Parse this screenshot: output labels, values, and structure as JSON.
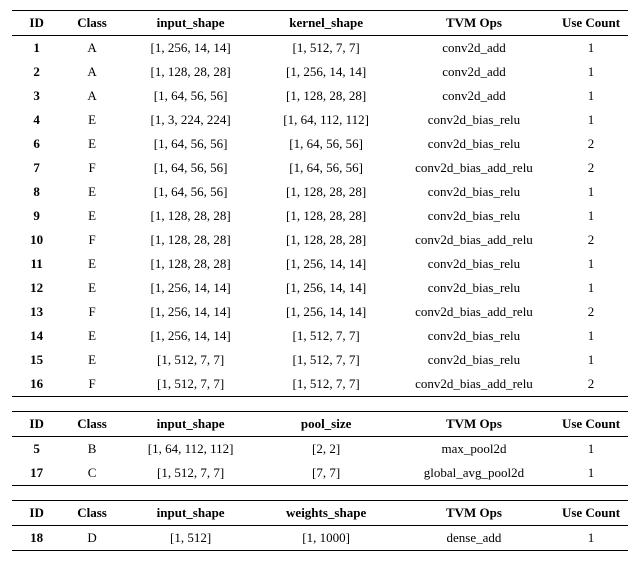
{
  "tables": [
    {
      "headers": {
        "id": "ID",
        "class": "Class",
        "input_shape": "input_shape",
        "misc": "kernel_shape",
        "ops": "TVM Ops",
        "use_count": "Use Count"
      },
      "rows": [
        {
          "id": "1",
          "class": "A",
          "input_shape": "[1, 256, 14, 14]",
          "misc": "[1, 512, 7, 7]",
          "ops": "conv2d_add",
          "use_count": "1"
        },
        {
          "id": "2",
          "class": "A",
          "input_shape": "[1, 128, 28, 28]",
          "misc": "[1, 256, 14, 14]",
          "ops": "conv2d_add",
          "use_count": "1"
        },
        {
          "id": "3",
          "class": "A",
          "input_shape": "[1, 64, 56, 56]",
          "misc": "[1, 128, 28, 28]",
          "ops": "conv2d_add",
          "use_count": "1"
        },
        {
          "id": "4",
          "class": "E",
          "input_shape": "[1, 3, 224, 224]",
          "misc": "[1, 64, 112, 112]",
          "ops": "conv2d_bias_relu",
          "use_count": "1"
        },
        {
          "id": "6",
          "class": "E",
          "input_shape": "[1, 64, 56, 56]",
          "misc": "[1, 64, 56, 56]",
          "ops": "conv2d_bias_relu",
          "use_count": "2"
        },
        {
          "id": "7",
          "class": "F",
          "input_shape": "[1, 64, 56, 56]",
          "misc": "[1, 64, 56, 56]",
          "ops": "conv2d_bias_add_relu",
          "use_count": "2"
        },
        {
          "id": "8",
          "class": "E",
          "input_shape": "[1, 64, 56, 56]",
          "misc": "[1, 128, 28, 28]",
          "ops": "conv2d_bias_relu",
          "use_count": "1"
        },
        {
          "id": "9",
          "class": "E",
          "input_shape": "[1, 128, 28, 28]",
          "misc": "[1, 128, 28, 28]",
          "ops": "conv2d_bias_relu",
          "use_count": "1"
        },
        {
          "id": "10",
          "class": "F",
          "input_shape": "[1, 128, 28, 28]",
          "misc": "[1, 128, 28, 28]",
          "ops": "conv2d_bias_add_relu",
          "use_count": "2"
        },
        {
          "id": "11",
          "class": "E",
          "input_shape": "[1, 128, 28, 28]",
          "misc": "[1, 256, 14, 14]",
          "ops": "conv2d_bias_relu",
          "use_count": "1"
        },
        {
          "id": "12",
          "class": "E",
          "input_shape": "[1, 256, 14, 14]",
          "misc": "[1, 256, 14, 14]",
          "ops": "conv2d_bias_relu",
          "use_count": "1"
        },
        {
          "id": "13",
          "class": "F",
          "input_shape": "[1, 256, 14, 14]",
          "misc": "[1, 256, 14, 14]",
          "ops": "conv2d_bias_add_relu",
          "use_count": "2"
        },
        {
          "id": "14",
          "class": "E",
          "input_shape": "[1, 256, 14, 14]",
          "misc": "[1, 512, 7, 7]",
          "ops": "conv2d_bias_relu",
          "use_count": "1"
        },
        {
          "id": "15",
          "class": "E",
          "input_shape": "[1, 512, 7, 7]",
          "misc": "[1, 512, 7, 7]",
          "ops": "conv2d_bias_relu",
          "use_count": "1"
        },
        {
          "id": "16",
          "class": "F",
          "input_shape": "[1, 512, 7, 7]",
          "misc": "[1, 512, 7, 7]",
          "ops": "conv2d_bias_add_relu",
          "use_count": "2"
        }
      ]
    },
    {
      "headers": {
        "id": "ID",
        "class": "Class",
        "input_shape": "input_shape",
        "misc": "pool_size",
        "ops": "TVM Ops",
        "use_count": "Use Count"
      },
      "rows": [
        {
          "id": "5",
          "class": "B",
          "input_shape": "[1, 64, 112, 112]",
          "misc": "[2, 2]",
          "ops": "max_pool2d",
          "use_count": "1"
        },
        {
          "id": "17",
          "class": "C",
          "input_shape": "[1, 512, 7, 7]",
          "misc": "[7, 7]",
          "ops": "global_avg_pool2d",
          "use_count": "1"
        }
      ]
    },
    {
      "headers": {
        "id": "ID",
        "class": "Class",
        "input_shape": "input_shape",
        "misc": "weights_shape",
        "ops": "TVM Ops",
        "use_count": "Use Count"
      },
      "rows": [
        {
          "id": "18",
          "class": "D",
          "input_shape": "[1, 512]",
          "misc": "[1, 1000]",
          "ops": "dense_add",
          "use_count": "1"
        }
      ]
    }
  ]
}
